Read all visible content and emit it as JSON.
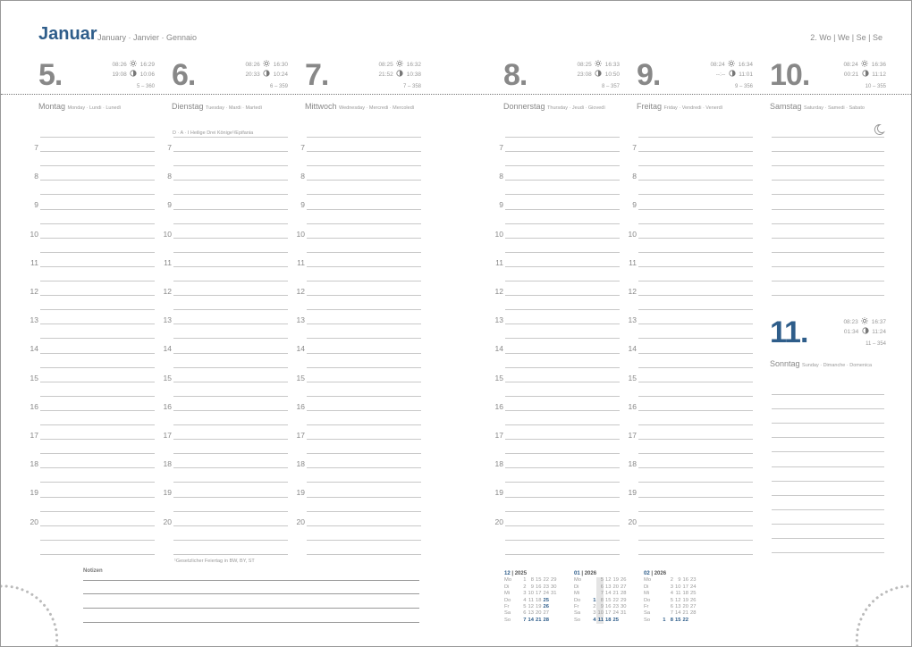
{
  "header": {
    "month": "Januar",
    "month_translations": "January · Janvier · Gennaio",
    "week": "2. Wo | We | Se | Se"
  },
  "days": [
    {
      "num": "5.",
      "sunrise": "08:26",
      "sunset": "16:29",
      "moonrise": "19:08",
      "moonset": "10:06",
      "doy": "5 – 360",
      "name": "Montag",
      "translations": "Monday · Lundi · Lunedì"
    },
    {
      "num": "6.",
      "sunrise": "08:26",
      "sunset": "16:30",
      "moonrise": "20:33",
      "moonset": "10:24",
      "doy": "6 – 359",
      "name": "Dienstag",
      "translations": "Tuesday · Mardi · Martedì"
    },
    {
      "num": "7.",
      "sunrise": "08:25",
      "sunset": "16:32",
      "moonrise": "21:52",
      "moonset": "10:38",
      "doy": "7 – 358",
      "name": "Mittwoch",
      "translations": "Wednesday · Mercredi · Mercoledì"
    },
    {
      "num": "8.",
      "sunrise": "08:25",
      "sunset": "16:33",
      "moonrise": "23:08",
      "moonset": "10:50",
      "doy": "8 – 357",
      "name": "Donnerstag",
      "translations": "Thursday · Jeudi · Giovedì"
    },
    {
      "num": "9.",
      "sunrise": "08:24",
      "sunset": "16:34",
      "moonrise": "--:--",
      "moonset": "11:01",
      "doy": "9 – 356",
      "name": "Freitag",
      "translations": "Friday · Vendredi · Venerdì"
    },
    {
      "num": "10.",
      "sunrise": "08:24",
      "sunset": "16:36",
      "moonrise": "00:21",
      "moonset": "11:12",
      "doy": "10 – 355",
      "name": "Samstag",
      "translations": "Saturday · Samedi · Sabato"
    },
    {
      "num": "11.",
      "sunrise": "08:23",
      "sunset": "16:37",
      "moonrise": "01:34",
      "moonset": "11:24",
      "doy": "11 – 354",
      "name": "Sonntag",
      "translations": "Sunday · Dimanche · Domenica"
    }
  ],
  "hours": [
    "7",
    "8",
    "9",
    "10",
    "11",
    "12",
    "13",
    "14",
    "15",
    "16",
    "17",
    "18",
    "19",
    "20"
  ],
  "holiday": "D · A · I   Heilige Drei Könige¹/Epifania",
  "footnote": "¹Gesetzlicher Feiertag in BW, BY, ST",
  "notes_title": "Notizen",
  "icons": {
    "sun": "sun-icon",
    "moon": "moon-phase-icon",
    "last_quarter": "crescent-moon-icon"
  },
  "mini_calendars": [
    {
      "month": "12",
      "year": "2025",
      "rows": [
        {
          "wd": "Mo",
          "days": [
            "1",
            "8",
            "15",
            "22",
            "29"
          ]
        },
        {
          "wd": "Di",
          "days": [
            "2",
            "9",
            "16",
            "23",
            "30"
          ]
        },
        {
          "wd": "Mi",
          "days": [
            "3",
            "10",
            "17",
            "24",
            "31"
          ]
        },
        {
          "wd": "Do",
          "days": [
            "4",
            "11",
            "18",
            "25",
            ""
          ]
        },
        {
          "wd": "Fr",
          "days": [
            "5",
            "12",
            "19",
            "26",
            ""
          ]
        },
        {
          "wd": "Sa",
          "days": [
            "6",
            "13",
            "20",
            "27",
            ""
          ]
        },
        {
          "wd": "So",
          "days": [
            "7",
            "14",
            "21",
            "28",
            ""
          ]
        }
      ]
    },
    {
      "month": "01",
      "year": "2026",
      "rows": [
        {
          "wd": "Mo",
          "days": [
            "",
            "5",
            "12",
            "19",
            "26"
          ]
        },
        {
          "wd": "Di",
          "days": [
            "",
            "6",
            "13",
            "20",
            "27"
          ]
        },
        {
          "wd": "Mi",
          "days": [
            "",
            "7",
            "14",
            "21",
            "28"
          ]
        },
        {
          "wd": "Do",
          "days": [
            "1",
            "8",
            "15",
            "22",
            "29"
          ]
        },
        {
          "wd": "Fr",
          "days": [
            "2",
            "9",
            "16",
            "23",
            "30"
          ]
        },
        {
          "wd": "Sa",
          "days": [
            "3",
            "10",
            "17",
            "24",
            "31"
          ]
        },
        {
          "wd": "So",
          "days": [
            "4",
            "11",
            "18",
            "25",
            ""
          ]
        }
      ]
    },
    {
      "month": "02",
      "year": "2026",
      "rows": [
        {
          "wd": "Mo",
          "days": [
            "",
            "2",
            "9",
            "16",
            "23"
          ]
        },
        {
          "wd": "Di",
          "days": [
            "",
            "3",
            "10",
            "17",
            "24"
          ]
        },
        {
          "wd": "Mi",
          "days": [
            "",
            "4",
            "11",
            "18",
            "25"
          ]
        },
        {
          "wd": "Do",
          "days": [
            "",
            "5",
            "12",
            "19",
            "26"
          ]
        },
        {
          "wd": "Fr",
          "days": [
            "",
            "6",
            "13",
            "20",
            "27"
          ]
        },
        {
          "wd": "Sa",
          "days": [
            "",
            "7",
            "14",
            "21",
            "28"
          ]
        },
        {
          "wd": "So",
          "days": [
            "1",
            "8",
            "15",
            "22",
            ""
          ]
        }
      ]
    }
  ]
}
